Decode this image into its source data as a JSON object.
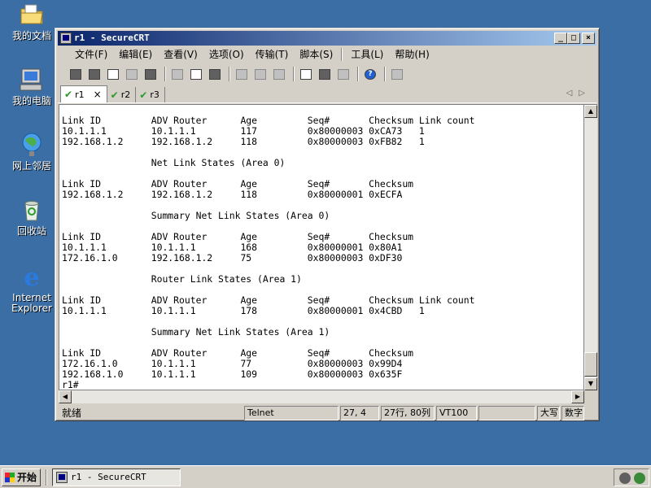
{
  "desktop": {
    "icons": [
      {
        "label": "我的文档"
      },
      {
        "label": "我的电脑"
      },
      {
        "label": "网上邻居"
      },
      {
        "label": "回收站"
      },
      {
        "label": "Internet Explorer"
      }
    ]
  },
  "window": {
    "title": "r1 - SecureCRT",
    "buttons": {
      "minimize": "_",
      "maximize": "□",
      "close": "×"
    }
  },
  "menu": {
    "items": [
      "文件(F)",
      "编辑(E)",
      "查看(V)",
      "选项(O)",
      "传输(T)",
      "脚本(S)",
      "工具(L)",
      "帮助(H)"
    ]
  },
  "tabs": {
    "items": [
      {
        "label": "r1",
        "close": "×"
      },
      {
        "label": "r2"
      },
      {
        "label": "r3"
      }
    ],
    "check": "✔",
    "arrows": "◁▷"
  },
  "terminal": {
    "lines": [
      "Link ID         ADV Router      Age         Seq#       Checksum Link count",
      "10.1.1.1        10.1.1.1        117         0x80000003 0xCA73   1",
      "192.168.1.2     192.168.1.2     118         0x80000003 0xFB82   1",
      "",
      "                Net Link States (Area 0)",
      "",
      "Link ID         ADV Router      Age         Seq#       Checksum",
      "192.168.1.2     192.168.1.2     118         0x80000001 0xECFA",
      "",
      "                Summary Net Link States (Area 0)",
      "",
      "Link ID         ADV Router      Age         Seq#       Checksum",
      "10.1.1.1        10.1.1.1        168         0x80000001 0x80A1",
      "172.16.1.0      192.168.1.2     75          0x80000003 0xDF30",
      "",
      "                Router Link States (Area 1)",
      "",
      "Link ID         ADV Router      Age         Seq#       Checksum Link count",
      "10.1.1.1        10.1.1.1        178         0x80000001 0x4CBD   1",
      "",
      "                Summary Net Link States (Area 1)",
      "",
      "Link ID         ADV Router      Age         Seq#       Checksum",
      "172.16.1.0      10.1.1.1        77          0x80000003 0x99D4",
      "192.168.1.0     10.1.1.1        109         0x80000003 0x635F",
      "r1#"
    ]
  },
  "status": {
    "ready": "就绪",
    "protocol": "Telnet",
    "cursor": "27,  4",
    "size": "27行, 80列",
    "emulation": "VT100",
    "caps": "大写",
    "num": "数字"
  },
  "taskbar": {
    "start_label": "开始",
    "task_label": "r1 - SecureCRT"
  }
}
